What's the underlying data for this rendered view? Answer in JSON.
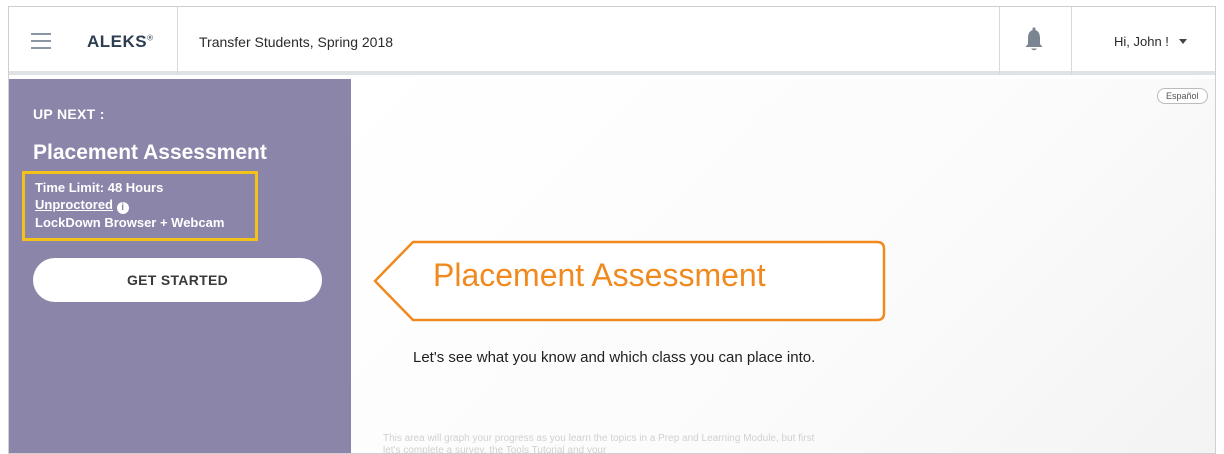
{
  "header": {
    "logo": "ALEKS",
    "logo_mark": "®",
    "class_name": "Transfer Students, Spring 2018",
    "greeting": "Hi, John !"
  },
  "sidebar": {
    "up_next": "UP NEXT :",
    "title": "Placement Assessment",
    "time_limit": "Time Limit: 48 Hours",
    "proctoring": "Unproctored",
    "browser": "LockDown Browser + Webcam",
    "start_button": "GET STARTED"
  },
  "main": {
    "language": "Español",
    "banner_title": "Placement Assessment",
    "intro": "Let's see what you know and which class you can place into.",
    "faded_note": "This area will graph your progress as you learn the topics in a Prep and Learning Module, but first let's complete a survey, the Tools Tutorial and your"
  },
  "colors": {
    "sidebar_bg": "#8a85a9",
    "highlight_border": "#f2c21b",
    "banner_accent": "#f08a1e"
  },
  "icons": [
    "hamburger-menu-icon",
    "bell-icon",
    "chevron-down-icon",
    "info-icon"
  ]
}
